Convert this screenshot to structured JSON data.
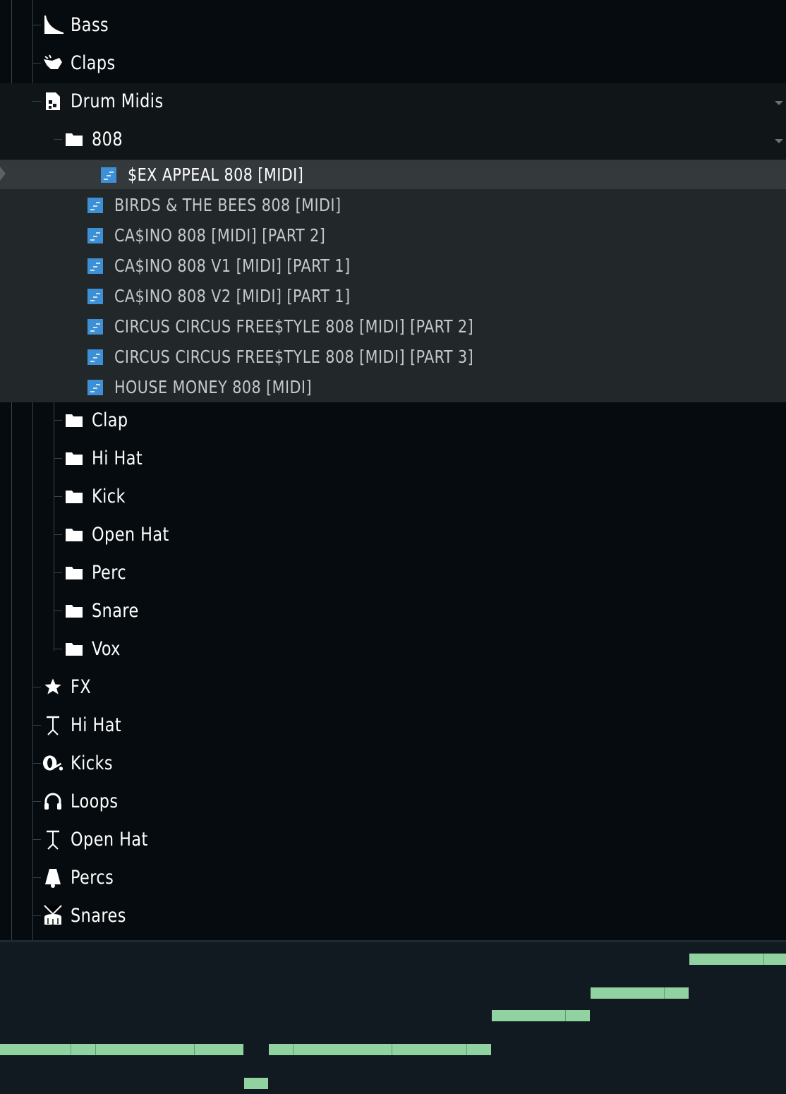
{
  "browser": {
    "folders": {
      "bass": "Bass",
      "claps": "Claps",
      "drum_midis": "Drum Midis",
      "fx": "FX",
      "hi_hat": "Hi Hat",
      "kicks": "Kicks",
      "loops": "Loops",
      "open_hat": "Open Hat",
      "percs": "Percs",
      "snares": "Snares"
    },
    "subfolders": {
      "f808": "808",
      "clap": "Clap",
      "hi_hat": "Hi Hat",
      "kick": "Kick",
      "open_hat": "Open Hat",
      "perc": "Perc",
      "snare": "Snare",
      "vox": "Vox"
    },
    "files": [
      "$EX APPEAL 808 [MIDI]",
      "BIRDS & THE BEES 808 [MIDI]",
      "CA$INO 808 [MIDI] [PART 2]",
      "CA$INO 808 V1 [MIDI] [PART 1]",
      "CA$INO 808 V2 [MIDI] [PART 1]",
      "CIRCUS CIRCUS FREE$TYLE 808 [MIDI] [PART 2]",
      "CIRCUS CIRCUS FREE$TYLE 808 [MIDI] [PART 3]",
      "HOUSE MONEY 808 [MIDI]"
    ],
    "selected_file_index": 0
  },
  "colors": {
    "background": "#050b0e",
    "selected_row": "#34393b",
    "midi_icon": "#3d8fd6",
    "note": "#90d3a1"
  }
}
